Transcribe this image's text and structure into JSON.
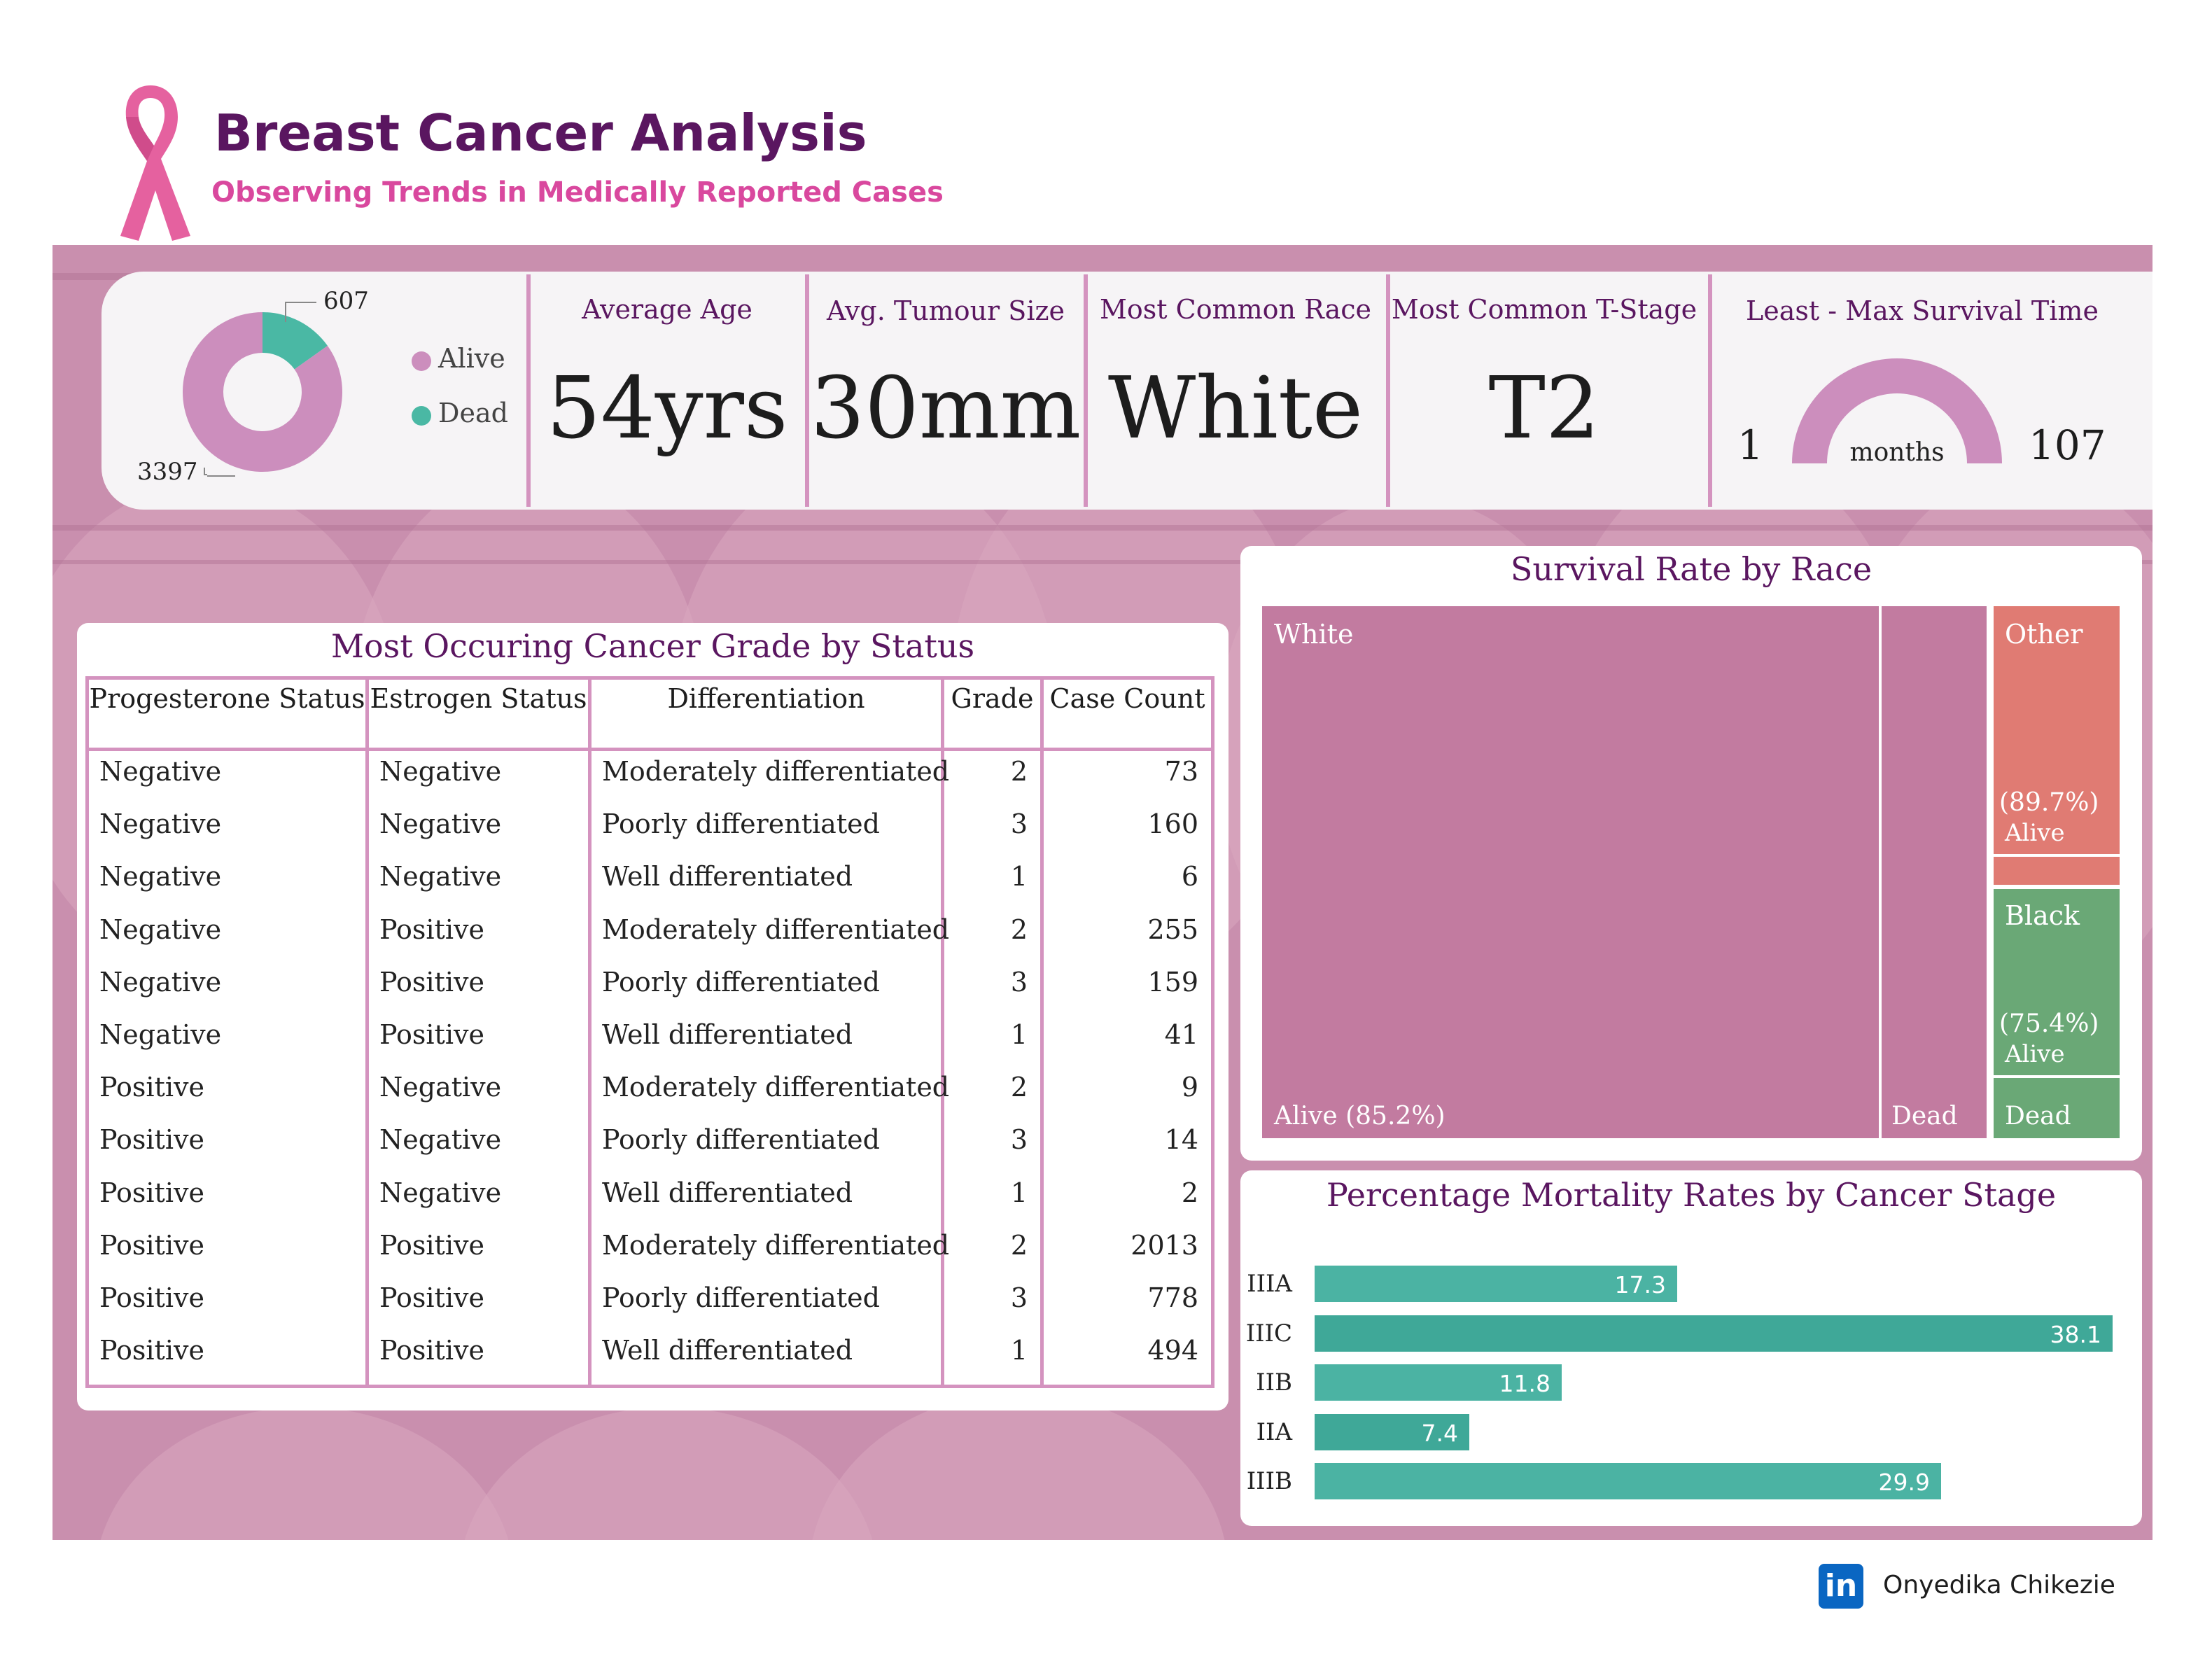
{
  "header": {
    "title": "Breast Cancer Analysis",
    "subtitle": "Observing Trends in Medically Reported Cases"
  },
  "kpis": {
    "status_donut": {
      "alive_count": "3397",
      "dead_count": "607",
      "legend_alive": "Alive",
      "legend_dead": "Dead"
    },
    "average_age": {
      "label": "Average Age",
      "value": "54yrs"
    },
    "avg_tumour_size": {
      "label": "Avg. Tumour Size",
      "value": "30mm"
    },
    "most_common_race": {
      "label": "Most Common Race",
      "value": "White"
    },
    "most_common_tstage": {
      "label": "Most Common T-Stage",
      "value": "T2"
    },
    "survival_time": {
      "label": "Least - Max Survival Time",
      "min": "1",
      "max": "107",
      "unit": "months"
    }
  },
  "table": {
    "title": "Most Occuring Cancer Grade by Status",
    "headers": [
      "Progesterone Status",
      "Estrogen Status",
      "Differentiation",
      "Grade",
      "Case Count"
    ],
    "rows": [
      [
        "Negative",
        "Negative",
        "Moderately differentiated",
        "2",
        "73"
      ],
      [
        "Negative",
        "Negative",
        "Poorly differentiated",
        "3",
        "160"
      ],
      [
        "Negative",
        "Negative",
        "Well differentiated",
        "1",
        "6"
      ],
      [
        "Negative",
        "Positive",
        "Moderately differentiated",
        "2",
        "255"
      ],
      [
        "Negative",
        "Positive",
        "Poorly differentiated",
        "3",
        "159"
      ],
      [
        "Negative",
        "Positive",
        "Well differentiated",
        "1",
        "41"
      ],
      [
        "Positive",
        "Negative",
        "Moderately differentiated",
        "2",
        "9"
      ],
      [
        "Positive",
        "Negative",
        "Poorly differentiated",
        "3",
        "14"
      ],
      [
        "Positive",
        "Negative",
        "Well differentiated",
        "1",
        "2"
      ],
      [
        "Positive",
        "Positive",
        "Moderately differentiated",
        "2",
        "2013"
      ],
      [
        "Positive",
        "Positive",
        "Poorly differentiated",
        "3",
        "778"
      ],
      [
        "Positive",
        "Positive",
        "Well differentiated",
        "1",
        "494"
      ]
    ]
  },
  "footer": {
    "author": "Onyedika Chikezie",
    "linkedin_glyph": "in"
  },
  "colors": {
    "alive": "#cc8ebd",
    "dead": "#4ab8a4",
    "treemap_white": "#c27ba0",
    "treemap_other": "#e07b73",
    "treemap_black": "#6aa876",
    "bar": "#4bb3a3",
    "title_purple": "#5a1660",
    "subtitle_pink": "#d9489e"
  },
  "chart_data": [
    {
      "type": "pie",
      "categories": [
        "Alive",
        "Dead"
      ],
      "values": [
        3397,
        607
      ],
      "legend": "right"
    },
    {
      "type": "gauge",
      "title": "Least - Max Survival Time",
      "min": 1,
      "max": 107,
      "unit": "months"
    },
    {
      "type": "treemap",
      "title": "Survival Rate by Race",
      "groups": [
        {
          "name": "White",
          "children": [
            {
              "name": "Alive",
              "label": "Alive (85.2%)",
              "value": 85.2
            },
            {
              "name": "Dead",
              "label": "Dead",
              "value": 14.8
            }
          ]
        },
        {
          "name": "Other",
          "children": [
            {
              "name": "Alive",
              "label": "(89.7%)",
              "value": 89.7
            },
            {
              "name": "Dead",
              "label": "",
              "value": 10.3
            }
          ]
        },
        {
          "name": "Black",
          "children": [
            {
              "name": "Alive",
              "label": "(75.4%)",
              "value": 75.4
            },
            {
              "name": "Dead",
              "label": "Dead",
              "value": 24.6
            }
          ]
        }
      ]
    },
    {
      "type": "bar",
      "orientation": "horizontal",
      "title": "Percentage Mortality Rates by Cancer Stage",
      "categories": [
        "IIIA",
        "IIIC",
        "IIB",
        "IIA",
        "IIIB"
      ],
      "values": [
        17.3,
        38.1,
        11.8,
        7.4,
        29.9
      ]
    }
  ]
}
